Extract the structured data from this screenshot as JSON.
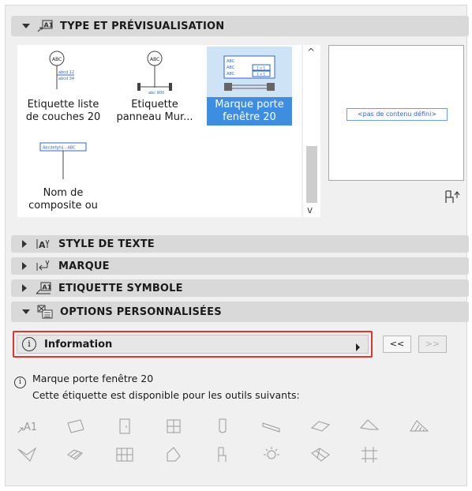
{
  "sections": {
    "type_preview": {
      "label": "TYPE ET PRÉVISUALISATION",
      "icon": "label-tag-icon"
    },
    "text_style": {
      "label": "STYLE DE TEXTE",
      "icon": "text-style-icon"
    },
    "marker": {
      "label": "MARQUE",
      "icon": "marker-icon"
    },
    "symbol_label": {
      "label": "ETIQUETTE SYMBOLE",
      "icon": "symbol-label-icon"
    },
    "custom_options": {
      "label": "OPTIONS PERSONNALISÉES",
      "icon": "custom-options-icon"
    }
  },
  "type_list": {
    "items": [
      {
        "name": "Etiquette liste de couches 20",
        "thumb_text": [
          "ABC",
          "abcd 12",
          "abcd 34"
        ],
        "selected": false
      },
      {
        "name": "Etiquette panneau Mur...",
        "thumb_text": [
          "ABC",
          "abc 900"
        ],
        "selected": false
      },
      {
        "name": "Marque porte fenêtre 20",
        "thumb_text": [
          "ABC",
          "ABC",
          "ABC",
          "1 x 1",
          "1 x 1"
        ],
        "selected": true
      },
      {
        "name": "Nom de composite ou ...",
        "thumb_text": [
          "Abcdefghij - ABC"
        ],
        "selected": false
      }
    ],
    "scroll_up": "^",
    "scroll_down": "v"
  },
  "preview": {
    "placeholder": "<pas de contenu défini>",
    "button_icon": "chair-preview-icon"
  },
  "custom": {
    "field_label": "Information",
    "prev_label": "<<",
    "next_label": ">>"
  },
  "description": {
    "line1": "Marque porte fenêtre 20",
    "line2": "Cette étiquette est disponible pour les outils suivants:"
  },
  "tools": {
    "label_text": "A1",
    "icons": [
      "label-tool-icon",
      "wall-tool-icon",
      "door-tool-icon",
      "window-tool-icon",
      "column-tool-icon",
      "beam-tool-icon",
      "slab-tool-icon",
      "roof-tool-icon",
      "fill-tool-icon",
      "shell-tool-icon",
      "stair-tool-icon",
      "curtain-wall-tool-icon",
      "morph-tool-icon",
      "object-tool-icon",
      "lamp-tool-icon",
      "mesh-tool-icon",
      "opening-tool-icon"
    ]
  },
  "colors": {
    "selection": "#3d8ee0",
    "highlight_border": "#e0342f",
    "header_bg": "#d9d9d9"
  }
}
